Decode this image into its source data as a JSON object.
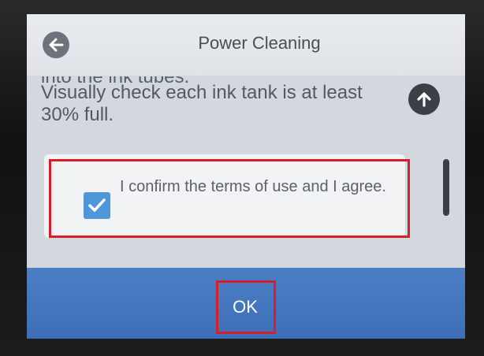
{
  "header": {
    "title": "Power Cleaning",
    "back_icon": "arrow-left-icon"
  },
  "message": {
    "cut_line": "into the ink tubes.",
    "text": "Visually check each ink tank is at least 30% full."
  },
  "scroll": {
    "up_icon": "arrow-up-icon"
  },
  "confirmation": {
    "checked": true,
    "text": "I confirm the terms of use and I agree."
  },
  "footer": {
    "ok_label": "OK"
  },
  "colors": {
    "accent_blue": "#3d6fb8",
    "checkbox_blue": "#4f98d8",
    "highlight_red": "#d71f2a"
  }
}
